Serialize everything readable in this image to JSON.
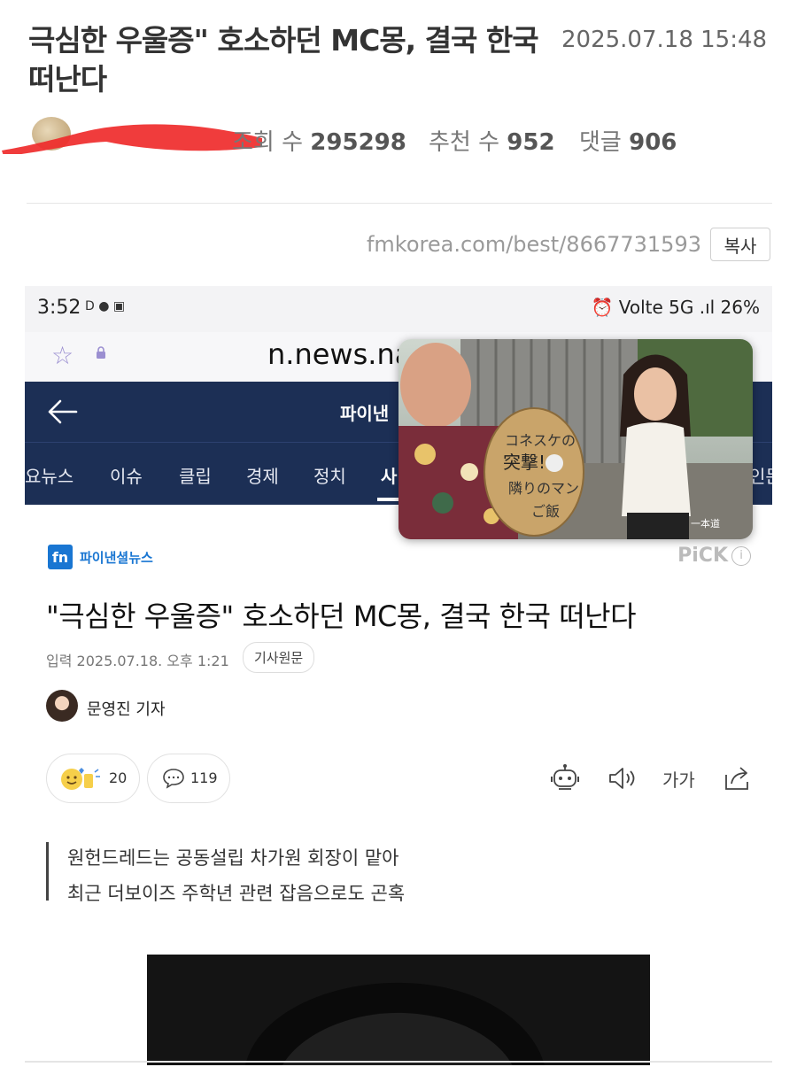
{
  "post": {
    "title": "극심한 우울증\" 호소하던 MC몽, 결국 한국 떠난다",
    "date": "2025.07.18 15:48",
    "views_label": "조회 수",
    "views": "295298",
    "likes_label": "추천 수",
    "likes": "952",
    "comments_label": "댓글",
    "comments": "906",
    "url": "fmkorea.com/best/8667731593",
    "copy_label": "복사"
  },
  "screenshot": {
    "status": {
      "time": "3:52",
      "left_icons": "D ● ▣",
      "right": "⏰ Volte 5G .ıl 26%"
    },
    "address": {
      "domain": "n.news.na"
    },
    "nav": {
      "title": "파이낸"
    },
    "categories": [
      "요뉴스",
      "이슈",
      "클립",
      "경제",
      "정치",
      "사",
      "인문"
    ],
    "publisher": {
      "logo_mark": "fn",
      "name": "파이낸셜뉴스",
      "pick": "PiCK",
      "pick_info": "i"
    },
    "article": {
      "title": "\"극심한 우울증\" 호소하던 MC몽, 결국 한국 떠난다",
      "date": "입력 2025.07.18. 오후 1:21",
      "source_button": "기사원문",
      "reporter": "문영진 기자",
      "reaction_count": "20",
      "comment_count": "119",
      "font_size_label": "가가",
      "summary": [
        "원헌드레드는 공동설립 차가원 회장이 맡아",
        "최근 더보이즈 주학년 관련 잡음으로도 곤혹"
      ]
    },
    "overlay": {
      "sign_text": "コネスケの突撃!隣りのマン ご飯",
      "watermark": "一本道"
    }
  }
}
